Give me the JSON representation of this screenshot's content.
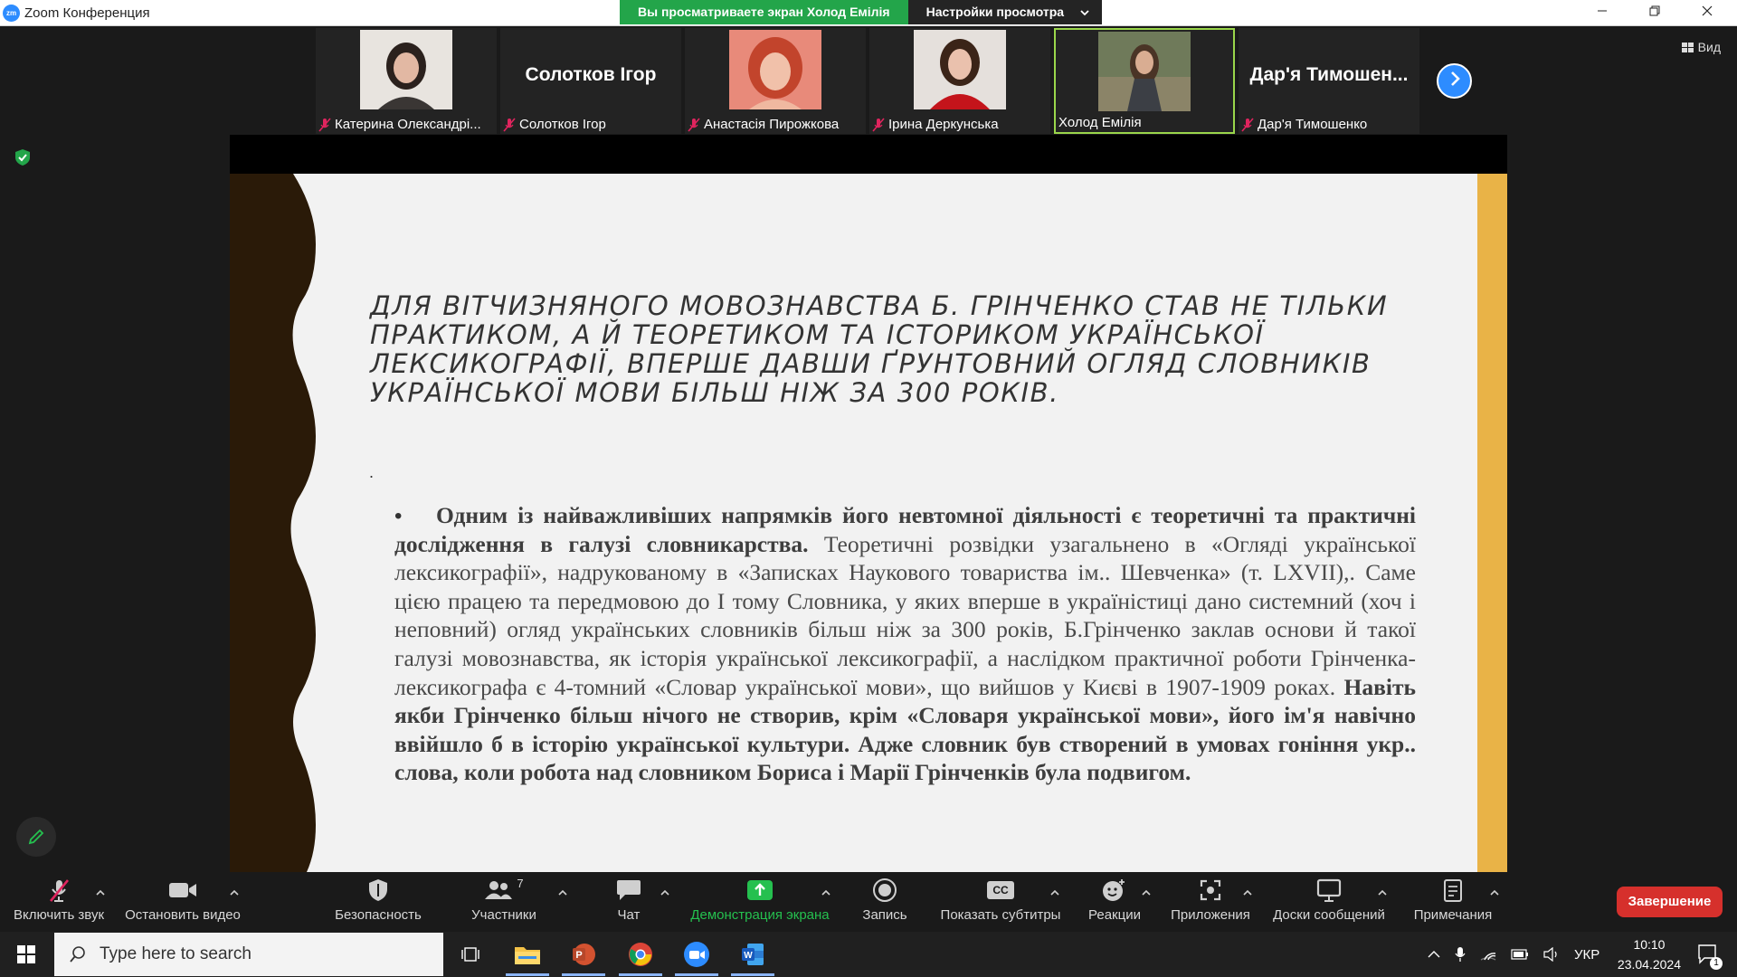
{
  "window": {
    "app_title": "Zoom Конференция",
    "logo_text": "zm",
    "share_banner": "Вы просматриваете экран Холод Емілія",
    "view_settings": "Настройки просмотра",
    "view_label": "Вид"
  },
  "participants": [
    {
      "name": "Катерина Олександрі...",
      "has_video": true,
      "muted": true,
      "active": false
    },
    {
      "name": "Солотков Ігор",
      "display_name": "Солотков Ігор",
      "has_video": false,
      "muted": true,
      "active": false
    },
    {
      "name": "Анастасія Пирожкова",
      "has_video": true,
      "muted": true,
      "active": false
    },
    {
      "name": "Ірина Деркунська",
      "has_video": true,
      "muted": true,
      "active": false
    },
    {
      "name": "Холод Емілія",
      "has_video": true,
      "muted": false,
      "active": true
    },
    {
      "name": "Дар'я Тимошенко",
      "display_name": "Дар'я Тимошен...",
      "has_video": false,
      "muted": true,
      "active": false
    }
  ],
  "slide": {
    "title": "ДЛЯ ВІТЧИЗНЯНОГО МОВОЗНАВСТВА Б. ГРІНЧЕНКО СТАВ НЕ ТІЛЬКИ ПРАКТИКОМ, А Й ТЕОРЕТИКОМ ТА ІСТОРИКОМ УКРАЇНСЬКОЇ ЛЕКСИКОГРАФІЇ, ВПЕРШЕ ДАВШИ ҐРУНТОВНИЙ ОГЛЯД СЛОВНИКІВ УКРАЇНСЬКОЇ МОВИ БІЛЬШ НІЖ ЗА 300 РОКІВ.",
    "dot": ".",
    "bullet": "•",
    "body_bold_1": "Одним із найважливіших напрямків його невтомної діяльності є теоретичні та практичні дослідження в галузі словникарства.",
    "body_regular": " Теоретичні розвідки узагальнено в «Огляді української лексикографії», надрукованому в «Записках Наукового товариства ім.. Шевченка» (т. LXVII),. Саме цією працею та передмовою до І тому Словника, у яких вперше в українiстиці дано системний (хоч і неповний) огляд українських словників більш ніж за 300 років, Б.Грінченко заклав основи й такої галузі мовознавства, як історія української лексикографії,  а наслідком практичної роботи Грінченка-лексикографа є 4-томний «Словар української мови», що вийшов у Києві в 1907-1909 роках. ",
    "body_bold_2": "Навіть якби Грінченко більш нічого не створив, крім «Словаря української мови», його ім'я навічно ввійшло б в історію української культури. Адже словник був створений в умовах гоніння укр.. слова, коли робота над словником Бориса і Марії Грінченків була подвигом."
  },
  "toolbar": {
    "unmute": "Включить звук",
    "stop_video": "Остановить видео",
    "security": "Безопасность",
    "participants": "Участники",
    "participants_count": "7",
    "chat": "Чат",
    "share_screen": "Демонстрация экрана",
    "record": "Запись",
    "captions": "Показать субтитры",
    "captions_icon": "CC",
    "reactions": "Реакции",
    "apps": "Приложения",
    "whiteboards": "Доски сообщений",
    "notes": "Примечания",
    "end": "Завершение"
  },
  "taskbar": {
    "search_placeholder": "Type here to search",
    "language": "УКР",
    "time": "10:10",
    "date": "23.04.2024",
    "notifications": "1"
  },
  "colors": {
    "zoom_blue": "#2d8cff",
    "share_green": "#23a54a",
    "end_red": "#d6302c",
    "slide_accent": "#e9b347",
    "slide_wave": "#2a1a08"
  }
}
